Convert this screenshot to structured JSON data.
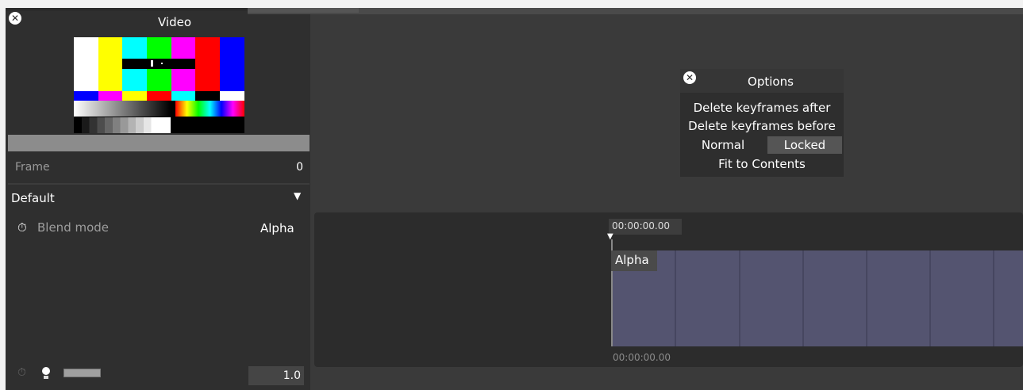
{
  "left_panel": {
    "close_glyph": "✕",
    "video_title": "Video",
    "frame_label": "Frame",
    "frame_value": "0",
    "section_title": "Default",
    "section_toggle_glyph": "▼",
    "blend_icon_glyph": "⏱",
    "blend_label": "Blend mode",
    "blend_value": "Alpha",
    "opacity_value": "1.0",
    "icons": [
      "close-icon",
      "stopwatch-icon",
      "timer-icon",
      "bulb-icon",
      "dropdown-arrow-icon"
    ]
  },
  "options_popup": {
    "close_glyph": "✕",
    "title": "Options",
    "items": [
      "Delete keyframes after",
      "Delete keyframes before"
    ],
    "mode_normal": "Normal",
    "mode_locked": "Locked",
    "fit_label": "Fit to Contents"
  },
  "timeline": {
    "time_badge": "00:00:00.00",
    "playhead_glyph": "▼",
    "clip_label": "Alpha",
    "footer_time": "00:00:00.00"
  },
  "colors": {
    "panel_bg": "#2f2f2f",
    "main_bg": "#3a3a3a",
    "track": "#545470",
    "locked_highlight": "#555555"
  }
}
